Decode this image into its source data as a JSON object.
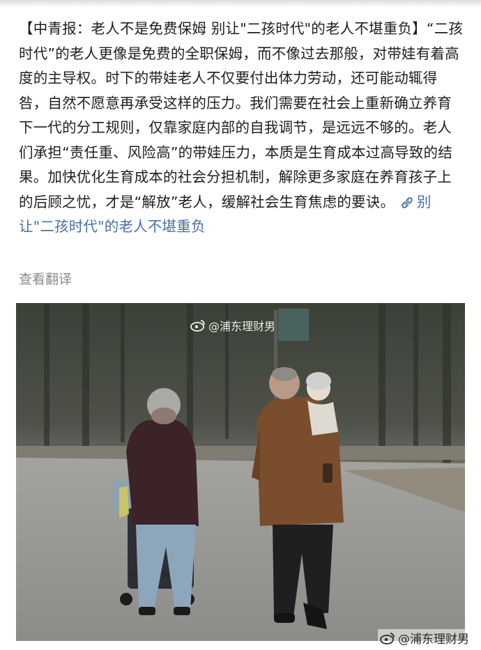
{
  "post": {
    "title": "【中青报：老人不是免费保姆 别让\"二孩时代\"的老人不堪重负】",
    "body": "“二孩时代”的老人更像是免费的全职保姆，而不像过去那般，对带娃有着高度的主导权。时下的带娃老人不仅要付出体力劳动，还可能动辄得咎，自然不愿意再承受这样的压力。我们需要在社会上重新确立养育下一代的分工规则，仅靠家庭内部的自我调节，是远远不够的。老人们承担“责任重、风险高”的带娃压力，本质是生育成本过高导致的结果。加快优化生育成本的社会分担机制，解除更多家庭在养育孩子上的后顾之忧，才是“解放”老人，缓解社会生育焦虑的要诀。",
    "link_text": "别让\"二孩时代\"的老人不堪重负",
    "link_icon": "chain-link-icon"
  },
  "translate_label": "查看翻译",
  "photo": {
    "watermark_top": "@浦东理财男",
    "watermark_bottom": "@浦东理财男",
    "watermark_icon": "weibo-icon"
  },
  "colors": {
    "text": "#1e1e1e",
    "link": "#4a6fa3",
    "muted": "#8a8a8a"
  }
}
